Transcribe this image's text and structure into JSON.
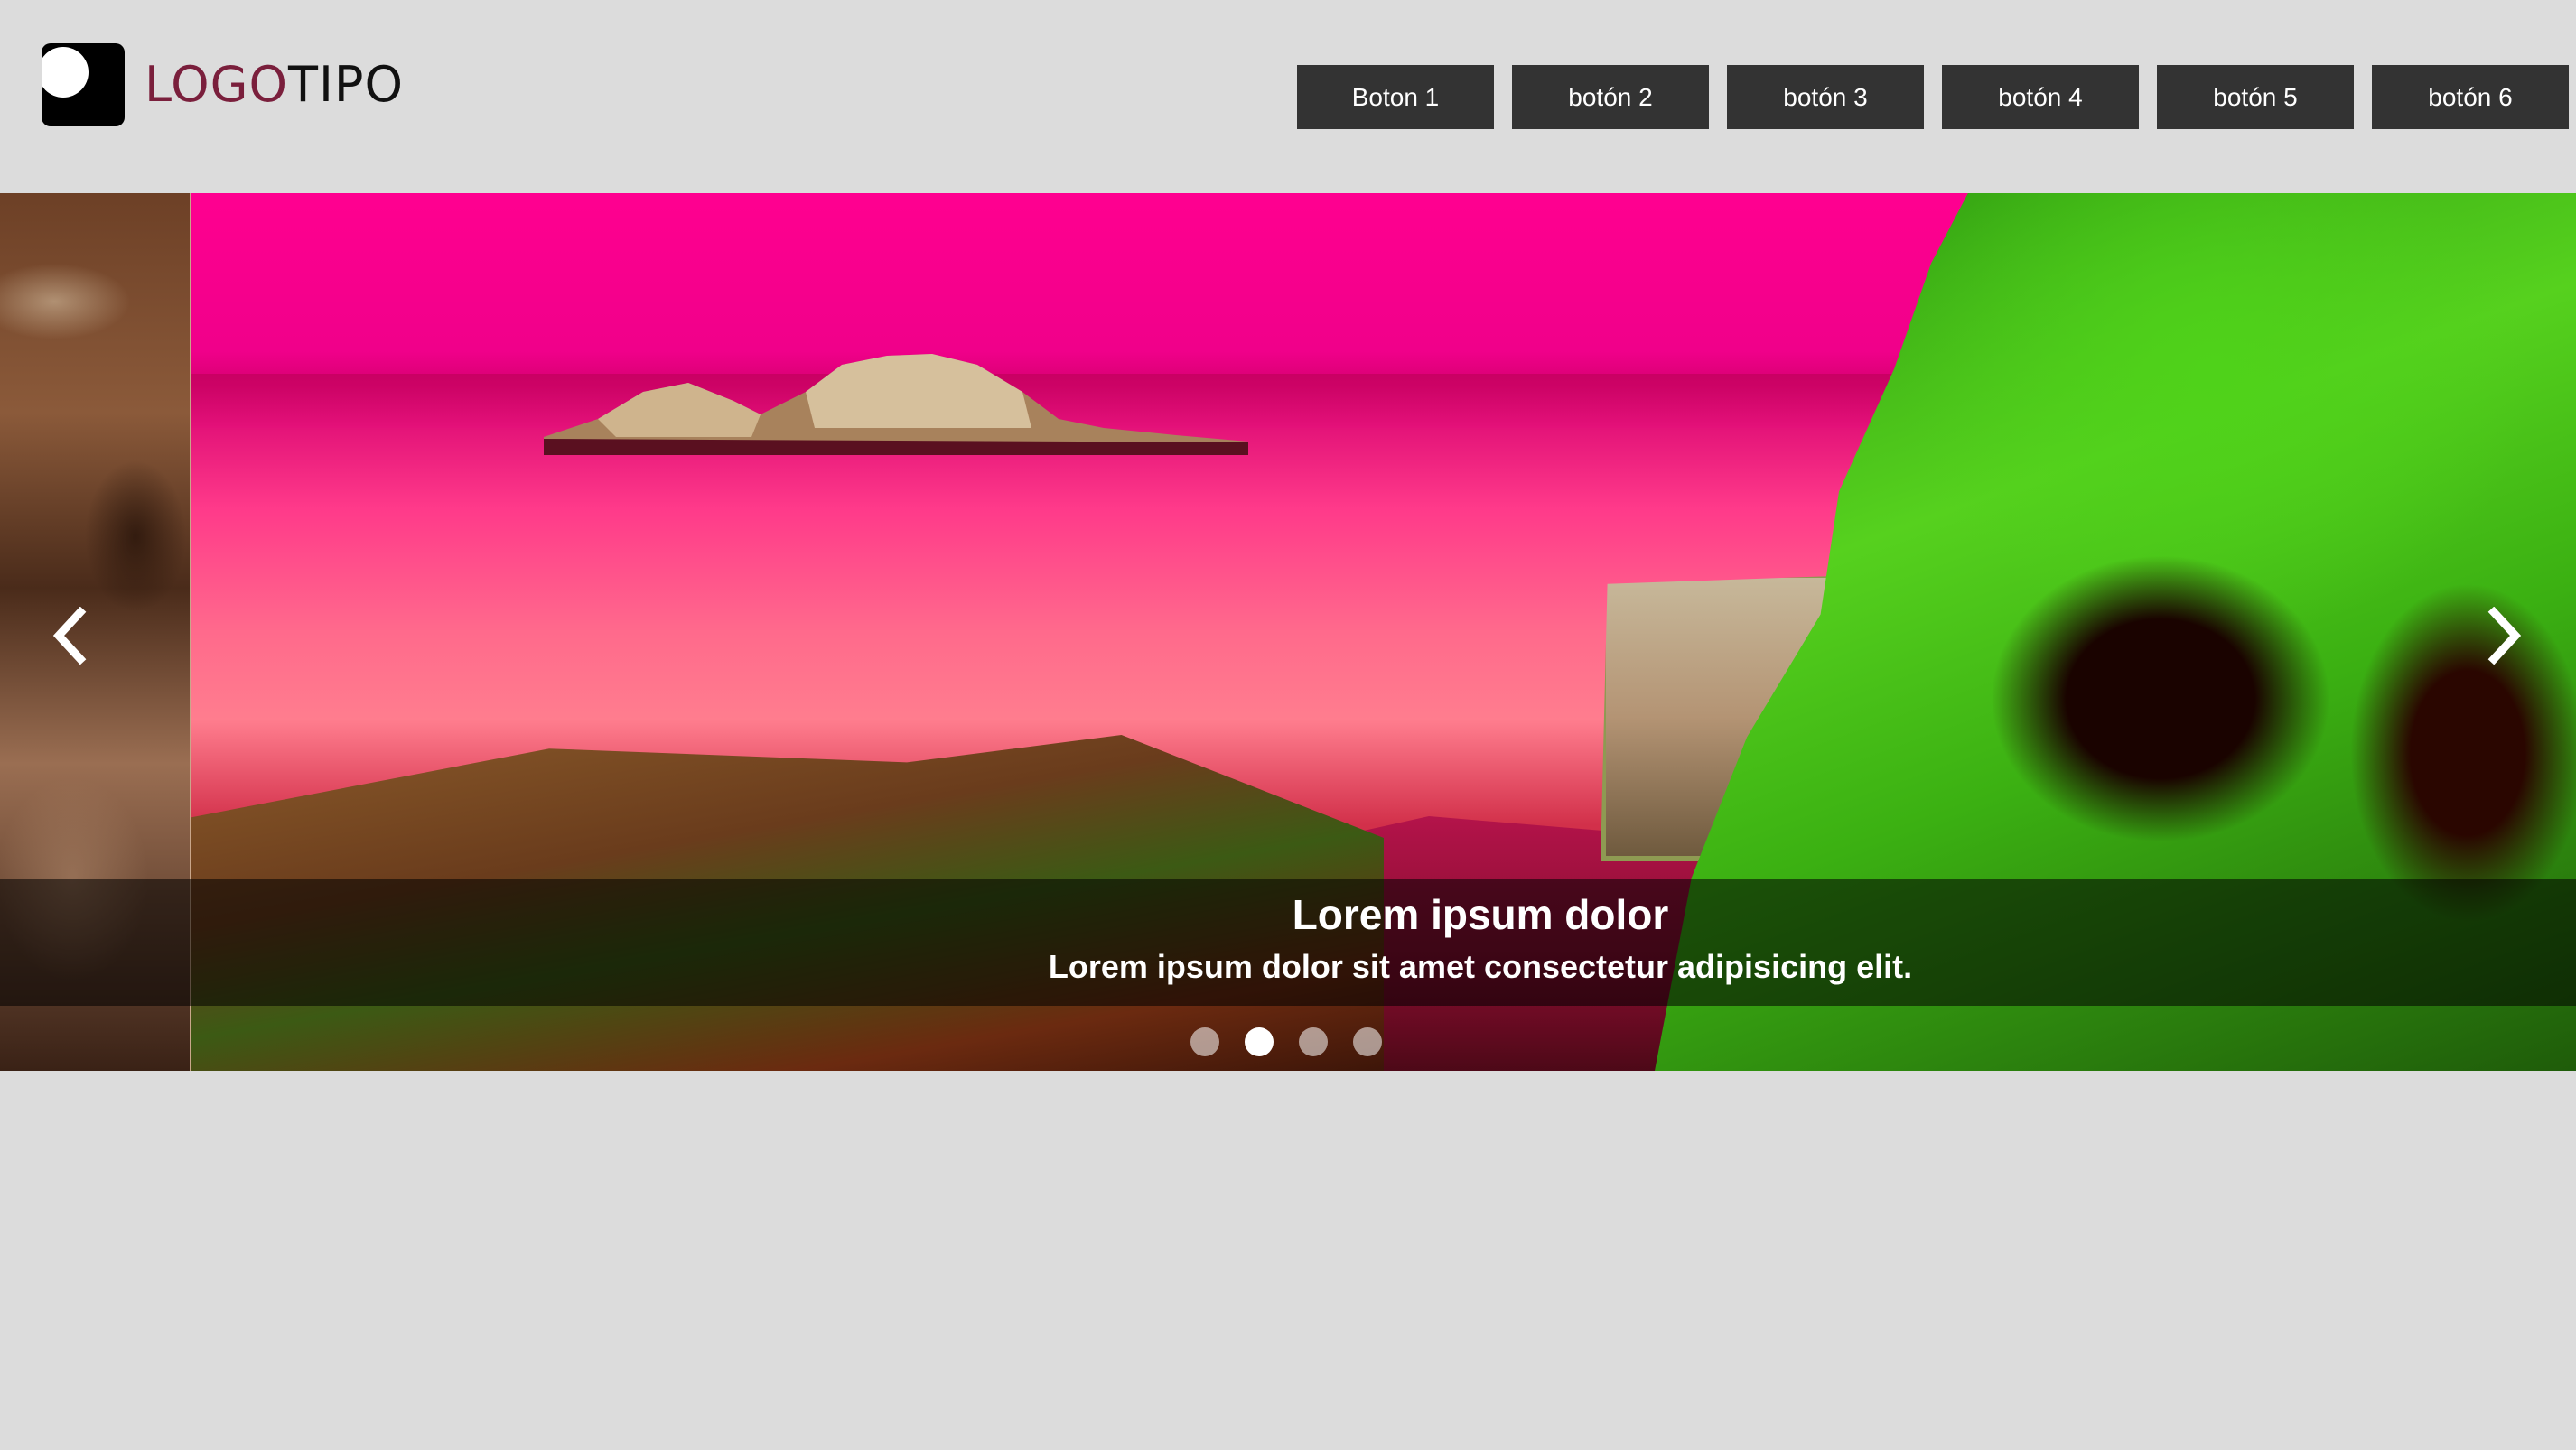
{
  "logo": {
    "part1": "LOGO",
    "part2": "TIPO",
    "part1_color": "#7a1f3c",
    "part2_color": "#111111"
  },
  "nav": {
    "buttons": [
      {
        "label": "Boton 1"
      },
      {
        "label": "botón 2"
      },
      {
        "label": "botón 3"
      },
      {
        "label": "botón 4"
      },
      {
        "label": "botón 5"
      },
      {
        "label": "botón 6"
      }
    ]
  },
  "slider": {
    "caption_title": "Lorem ipsum dolor",
    "caption_text": "Lorem ipsum dolor sit amet consectetur adipisicing elit.",
    "prev_icon": "chevron-left-icon",
    "next_icon": "chevron-right-icon",
    "slide_count": 4,
    "active_slide": 2
  },
  "colors": {
    "background": "#dcdcdc",
    "button_bg": "#333333",
    "button_text": "#ffffff"
  }
}
